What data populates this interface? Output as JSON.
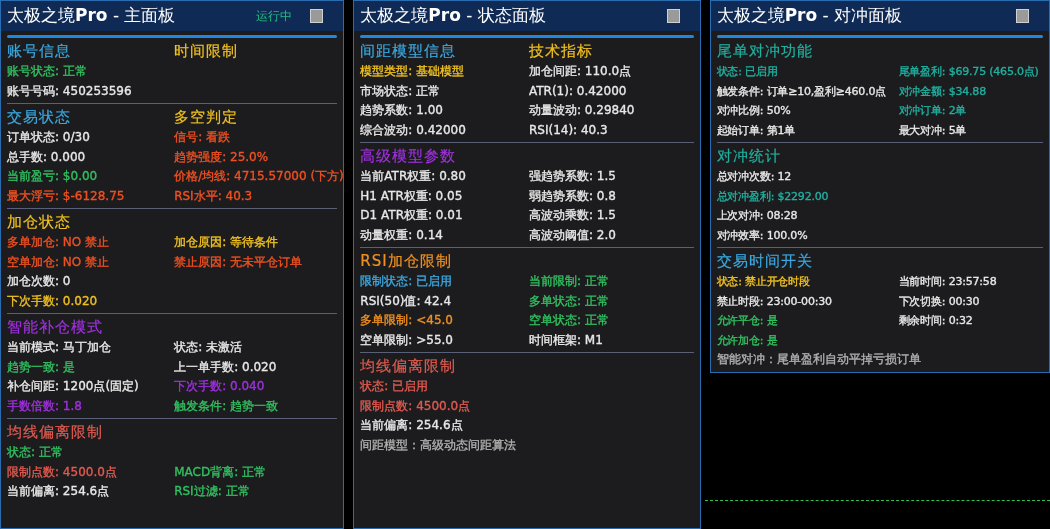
{
  "panels": [
    {
      "title_name": "太极之境",
      "title_suffix": "Pro",
      "title_rest": " - 主面板",
      "status": "运行中",
      "sections": [
        {
          "headings": [
            {
              "text": "账号信息",
              "color": "#3aa8e0"
            },
            {
              "text": "时间限制",
              "color": "#f0c020"
            }
          ],
          "rows": [
            {
              "left": {
                "text": "账号状态: 正常",
                "color": "#30c060"
              }
            },
            {
              "left": {
                "text": "账号号码: 450253596",
                "color": "#e8e8e8"
              }
            }
          ]
        },
        {
          "headings": [
            {
              "text": "交易状态",
              "color": "#3aa8e0"
            },
            {
              "text": "多空判定",
              "color": "#f0c020"
            }
          ],
          "rows": [
            {
              "left": {
                "text": "订单状态: 0/30",
                "color": "#e8e8e8"
              },
              "right": {
                "text": "信号: 看跌",
                "color": "#f05020"
              }
            },
            {
              "left": {
                "text": "总手数: 0.000",
                "color": "#e8e8e8"
              },
              "right": {
                "text": "趋势强度: 25.0%",
                "color": "#f05020"
              }
            },
            {
              "left": {
                "text": "当前盈亏: $0.00",
                "color": "#30c060"
              },
              "right": {
                "text": "价格/均线: 4715.57000 (下方)",
                "color": "#f05020"
              }
            },
            {
              "left": {
                "text": "最大浮亏: $-6128.75",
                "color": "#f05020"
              },
              "right": {
                "text": "RSI水平: 40.3",
                "color": "#f05020"
              }
            }
          ]
        },
        {
          "headings": [
            {
              "text": "加仓状态",
              "color": "#f0c020"
            }
          ],
          "rows": [
            {
              "left": {
                "text": "多单加仓: NO 禁止",
                "color": "#f05020"
              },
              "right": {
                "text": "加仓原因: 等待条件",
                "color": "#f0c020"
              }
            },
            {
              "left": {
                "text": "空单加仓: NO 禁止",
                "color": "#f05020"
              },
              "right": {
                "text": "禁止原因: 无未平仓订单",
                "color": "#f05020"
              }
            },
            {
              "left": {
                "text": "加仓次数: 0",
                "color": "#e8e8e8"
              }
            },
            {
              "left": {
                "text": "下次手数: 0.020",
                "color": "#f0c020"
              }
            }
          ]
        },
        {
          "headings": [
            {
              "text": "智能补仓模式",
              "color": "#a030e0"
            }
          ],
          "rows": [
            {
              "left": {
                "text": "当前模式: 马丁加仓",
                "color": "#e8e8e8"
              },
              "right": {
                "text": "状态: 未激活",
                "color": "#e8e8e8"
              }
            },
            {
              "left": {
                "text": "趋势一致: 是",
                "color": "#30c060"
              },
              "right": {
                "text": "上一单手数: 0.020",
                "color": "#e8e8e8"
              }
            },
            {
              "left": {
                "text": "补仓间距: 1200点(固定)",
                "color": "#e8e8e8"
              },
              "right": {
                "text": "下次手数: 0.040",
                "color": "#a030e0"
              }
            },
            {
              "left": {
                "text": "手数倍数: 1.8",
                "color": "#a030e0"
              },
              "right": {
                "text": "触发条件: 趋势一致",
                "color": "#30c060"
              }
            }
          ]
        },
        {
          "headings": [
            {
              "text": "均线偏离限制",
              "color": "#e05a50"
            }
          ],
          "rows": [
            {
              "left": {
                "text": "状态: 正常",
                "color": "#30c060"
              }
            },
            {
              "left": {
                "text": "限制点数: 4500.0点",
                "color": "#e05a50"
              },
              "right": {
                "text": "MACD背离: 正常",
                "color": "#30c060"
              }
            },
            {
              "left": {
                "text": "当前偏离: 254.6点",
                "color": "#e8e8e8"
              },
              "right": {
                "text": "RSI过滤: 正常",
                "color": "#30c060"
              }
            }
          ]
        }
      ]
    },
    {
      "title_name": "太极之境",
      "title_suffix": "Pro",
      "title_rest": " - 状态面板",
      "sections": [
        {
          "headings": [
            {
              "text": "间距模型信息",
              "color": "#3aa8e0"
            },
            {
              "text": "技术指标",
              "color": "#f0c020"
            }
          ],
          "rows": [
            {
              "left": {
                "text": "模型类型: 基础模型",
                "color": "#f0c020"
              },
              "right": {
                "text": "加仓间距: 110.0点",
                "color": "#e8e8e8"
              }
            },
            {
              "left": {
                "text": "市场状态: 正常",
                "color": "#e8e8e8"
              },
              "right": {
                "text": "ATR(1): 0.42000",
                "color": "#e8e8e8"
              }
            },
            {
              "left": {
                "text": "趋势系数: 1.00",
                "color": "#e8e8e8"
              },
              "right": {
                "text": "动量波动: 0.29840",
                "color": "#e8e8e8"
              }
            },
            {
              "left": {
                "text": "综合波动: 0.42000",
                "color": "#e8e8e8"
              },
              "right": {
                "text": "RSI(14): 40.3",
                "color": "#e8e8e8"
              }
            }
          ]
        },
        {
          "headings": [
            {
              "text": "高级模型参数",
              "color": "#a030e0"
            }
          ],
          "rows": [
            {
              "left": {
                "text": "当前ATR权重: 0.80",
                "color": "#e8e8e8"
              },
              "right": {
                "text": "强趋势系数: 1.5",
                "color": "#e8e8e8"
              }
            },
            {
              "left": {
                "text": "H1 ATR权重: 0.05",
                "color": "#e8e8e8"
              },
              "right": {
                "text": "弱趋势系数: 0.8",
                "color": "#e8e8e8"
              }
            },
            {
              "left": {
                "text": "D1 ATR权重: 0.01",
                "color": "#e8e8e8"
              },
              "right": {
                "text": "高波动乘数: 1.5",
                "color": "#e8e8e8"
              }
            },
            {
              "left": {
                "text": "动量权重: 0.14",
                "color": "#e8e8e8"
              },
              "right": {
                "text": "高波动阈值: 2.0",
                "color": "#e8e8e8"
              }
            }
          ]
        },
        {
          "headings": [
            {
              "text": "RSI加仓限制",
              "color": "#f09020"
            }
          ],
          "rows": [
            {
              "left": {
                "text": "限制状态: 已启用",
                "color": "#3aa8e0"
              },
              "right": {
                "text": "当前限制: 正常",
                "color": "#30c060"
              }
            },
            {
              "left": {
                "text": "RSI(50)值: 42.4",
                "color": "#e8e8e8"
              },
              "right": {
                "text": "多单状态: 正常",
                "color": "#30c060"
              }
            },
            {
              "left": {
                "text": "多单限制: <45.0",
                "color": "#f09020"
              },
              "right": {
                "text": "空单状态: 正常",
                "color": "#30c060"
              }
            },
            {
              "left": {
                "text": "空单限制: >55.0",
                "color": "#e8e8e8"
              },
              "right": {
                "text": "时间框架: M1",
                "color": "#e8e8e8"
              }
            }
          ]
        },
        {
          "headings": [
            {
              "text": "均线偏离限制",
              "color": "#e05a50"
            }
          ],
          "rows": [
            {
              "left": {
                "text": "状态: 已启用",
                "color": "#e05a50"
              }
            },
            {
              "left": {
                "text": "限制点数: 4500.0点",
                "color": "#e05a50"
              }
            },
            {
              "left": {
                "text": "当前偏离: 254.6点",
                "color": "#e8e8e8"
              }
            }
          ],
          "notes": [
            {
              "text": "间距模型：高级动态间距算法",
              "color": "#b0b0b0"
            }
          ]
        }
      ]
    },
    {
      "title_name": "太极之境",
      "title_suffix": "Pro",
      "title_rest": " - 对冲面板",
      "sections": [
        {
          "headings": [
            {
              "text": "尾单对冲功能",
              "color": "#20b0a0"
            }
          ],
          "rows": [
            {
              "left": {
                "text": "状态: 已启用",
                "color": "#20b0a0"
              },
              "right": {
                "text": "尾单盈利: $69.75 (465.0点)",
                "color": "#20b0a0"
              }
            },
            {
              "left": {
                "text": "触发条件: 订单≥10,盈利≥460.0点",
                "color": "#e8e8e8"
              },
              "right": {
                "text": "对冲金额: $34.88",
                "color": "#20b0a0"
              }
            },
            {
              "left": {
                "text": "对冲比例: 50%",
                "color": "#e8e8e8"
              },
              "right": {
                "text": "对冲订单: 2单",
                "color": "#20b0a0"
              }
            },
            {
              "left": {
                "text": "起始订单: 第1单",
                "color": "#e8e8e8"
              },
              "right": {
                "text": "最大对冲: 5单",
                "color": "#e8e8e8"
              }
            }
          ]
        },
        {
          "headings": [
            {
              "text": "对冲统计",
              "color": "#20b0a0"
            }
          ],
          "rows": [
            {
              "left": {
                "text": "总对冲次数: 12",
                "color": "#e8e8e8"
              }
            },
            {
              "left": {
                "text": "总对冲盈利: $2292.00",
                "color": "#20b0a0"
              }
            },
            {
              "left": {
                "text": "上次对冲: 08:28",
                "color": "#e8e8e8"
              }
            },
            {
              "left": {
                "text": "对冲效率: 100.0%",
                "color": "#e8e8e8"
              }
            }
          ]
        },
        {
          "headings": [
            {
              "text": "交易时间开关",
              "color": "#3aa8e0"
            }
          ],
          "rows": [
            {
              "left": {
                "text": "状态: 禁止开仓时段",
                "color": "#f0c020"
              },
              "right": {
                "text": "当前时间: 23:57:58",
                "color": "#e8e8e8"
              }
            },
            {
              "left": {
                "text": "禁止时段: 23:00-00:30",
                "color": "#e8e8e8"
              },
              "right": {
                "text": "下次切换: 00:30",
                "color": "#e8e8e8"
              }
            },
            {
              "left": {
                "text": "允许平仓: 是",
                "color": "#30c060"
              },
              "right": {
                "text": "剩余时间: 0:32",
                "color": "#e8e8e8"
              }
            },
            {
              "left": {
                "text": "允许加仓: 是",
                "color": "#30c060"
              }
            }
          ],
          "notes": [
            {
              "text": "智能对冲：尾单盈利自动平掉亏损订单",
              "color": "#b0b0b0"
            }
          ]
        }
      ]
    }
  ]
}
